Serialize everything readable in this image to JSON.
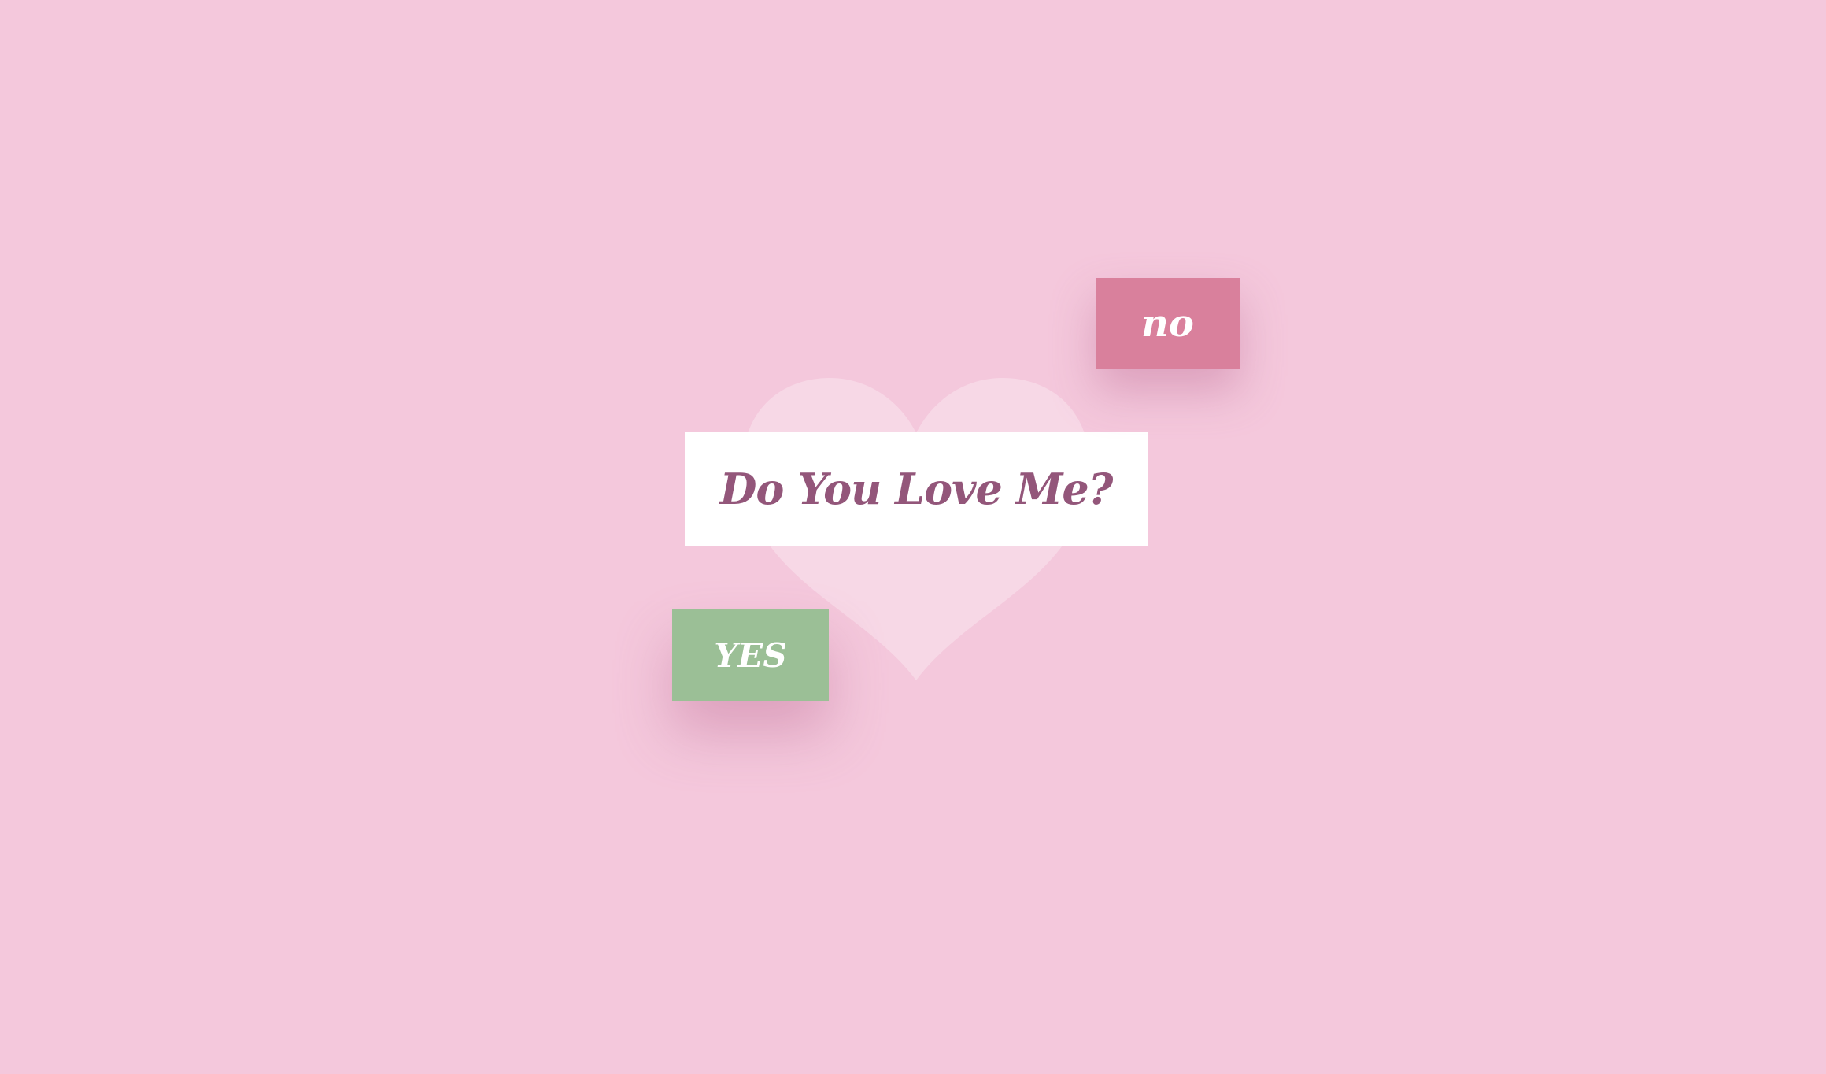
{
  "question": {
    "text": "Do You Love Me?"
  },
  "buttons": {
    "no_label": "no",
    "yes_label": "YES"
  },
  "colors": {
    "background": "#f4c8dc",
    "heart": "#f7d8e6",
    "question_card": "#ffffff",
    "question_text": "#93567a",
    "no_button": "#d9809c",
    "yes_button": "#9bbf96",
    "button_text": "#ffffff"
  },
  "icons": {
    "background_heart": "heart-icon"
  }
}
